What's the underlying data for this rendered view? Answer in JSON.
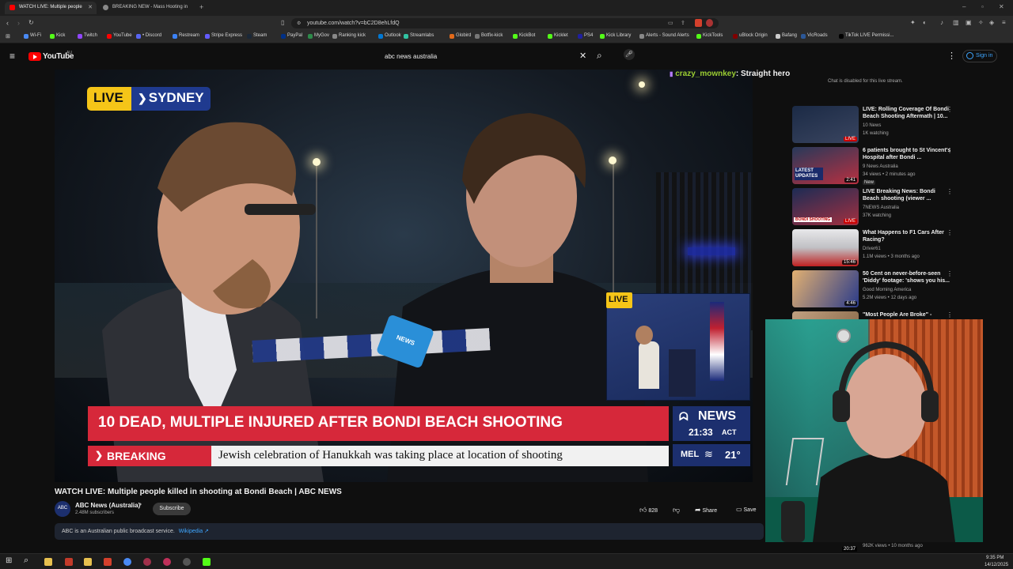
{
  "browser": {
    "tabs": [
      {
        "label": "WATCH LIVE: Multiple people",
        "active": true
      },
      {
        "label": "BREAKING NEW - Mass Hooting in",
        "active": false
      }
    ],
    "url": "youtube.com/watch?v=bC2D8ehLfdQ",
    "bookmarks": [
      "Wi-Fi",
      "Kick",
      "Twitch",
      "YouTube",
      "• Discord",
      "Restream",
      "Stripe Express",
      "Steam",
      "PayPal",
      "MyGov",
      "Ranking kick",
      "Outlook",
      "Streamlabs",
      "Globird",
      "Botfix-kick",
      "KickBot",
      "Kicklet",
      "PS4",
      "Kick Library",
      "Alerts - Sound Alerts",
      "KickTools",
      "uBlock Origin",
      "Bafang",
      "VicRoads",
      "TikTok LIVE Permissi..."
    ],
    "bookmark_colors": [
      "#4a8af4",
      "#53fc18",
      "#9146ff",
      "#ff0000",
      "#5865f2",
      "#3b82f6",
      "#635bff",
      "#1b2838",
      "#003087",
      "#2d8a4a",
      "#888",
      "#0078d4",
      "#31c3a2",
      "#e36a1a",
      "#777",
      "#53fc18",
      "#53fc18",
      "#1f1f9f",
      "#53fc18",
      "#888",
      "#53fc18",
      "#800000",
      "#ccc",
      "#2b5797",
      "#000"
    ]
  },
  "youtube": {
    "logo_text": "YouTube",
    "region": "AU",
    "search_value": "abc news australia",
    "sign_in": "Sign in"
  },
  "video": {
    "live_label": "LIVE",
    "city_label": "SYDNEY",
    "pip_live": "LIVE",
    "headline": "10 DEAD, MULTIPLE INJURED AFTER BONDI BEACH SHOOTING",
    "breaking_label": "BREAKING",
    "ticker": "Jewish celebration of Hanukkah was taking place at location of shooting",
    "brand": "NEWS",
    "time": "21:33",
    "tz": "ACT",
    "city_short": "MEL",
    "temp": "21°",
    "mic_flag": "NEWS"
  },
  "meta": {
    "title": "WATCH LIVE: Multiple people killed in shooting at Bondi Beach | ABC NEWS",
    "channel": "ABC News (Australia)",
    "subscribers": "2.48M subscribers",
    "subscribe": "Subscribe",
    "likes": "828",
    "share": "Share",
    "save": "Save",
    "info_text": "ABC is an Australian public broadcast service.",
    "info_link": "Wikipedia ↗"
  },
  "chat": {
    "username": "crazy_mownkey",
    "message": ": Straight hero",
    "disabled": "Chat is disabled for this live stream."
  },
  "recommendations": [
    {
      "title": "LIVE: Rolling Coverage Of Bondi Beach Shooting Aftermath | 10...",
      "channel": "10 News",
      "meta": "1K watching",
      "badge": "LIVE",
      "new": ""
    },
    {
      "title": "6 patients brought to St Vincent's Hospital after Bondi ...",
      "channel": "9 News Australia",
      "meta": "34 views • 2 minutes ago",
      "badge": "2:41",
      "new": "New"
    },
    {
      "title": "LIVE Breaking News: Bondi Beach shooting (viewer ...",
      "channel": "7NEWS Australia",
      "meta": "37K watching",
      "badge": "LIVE",
      "new": ""
    },
    {
      "title": "What Happens to F1 Cars After Racing?",
      "channel": "Driver61",
      "meta": "1.1M views • 3 months ago",
      "badge": "15:46",
      "new": ""
    },
    {
      "title": "50 Cent on never-before-seen 'Diddy' footage: 'shows you his...",
      "channel": "Good Morning America",
      "meta": "5.2M views • 12 days ago",
      "badge": "4:46",
      "new": ""
    },
    {
      "title": "\"Most People Are Broke\" -",
      "channel": "",
      "meta": "",
      "badge": "",
      "new": ""
    }
  ],
  "rec_hidden_meta": "962K views • 10 months ago",
  "rec_hidden_dur": "20:37",
  "thumb_texts": {
    "latest": "LATEST UPDATES",
    "bondi": "BONDI SHOOTING"
  },
  "taskbar": {
    "time": "9:35 PM",
    "date": "14/12/2025"
  },
  "colors": {
    "yt_red": "#ff0000",
    "abc_red": "#d6283a",
    "abc_blue": "#1c2f6e",
    "live_yellow": "#f5c518",
    "chat_green": "#9acd32"
  }
}
